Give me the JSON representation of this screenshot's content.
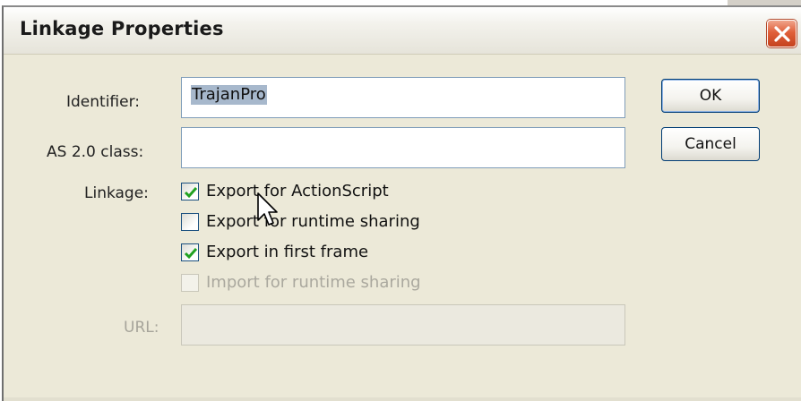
{
  "window": {
    "title": "Linkage Properties",
    "accent_close": "#d9542e"
  },
  "form": {
    "identifier": {
      "label": "Identifier:",
      "value": "TrajanPro"
    },
    "as_class": {
      "label": "AS 2.0 class:",
      "value": ""
    },
    "linkage_label": "Linkage:",
    "options": [
      {
        "label": "Export for ActionScript",
        "checked": true,
        "enabled": true
      },
      {
        "label": "Export for runtime sharing",
        "checked": false,
        "enabled": true
      },
      {
        "label": "Export in first frame",
        "checked": true,
        "enabled": true
      },
      {
        "label": "Import for runtime sharing",
        "checked": false,
        "enabled": false
      }
    ],
    "url": {
      "label": "URL:",
      "value": ""
    }
  },
  "buttons": {
    "ok_label": "OK",
    "cancel_label": "Cancel"
  },
  "icons": {
    "close": "close-x-icon",
    "check": "checkmark-icon",
    "cursor": "mouse-pointer-icon"
  }
}
